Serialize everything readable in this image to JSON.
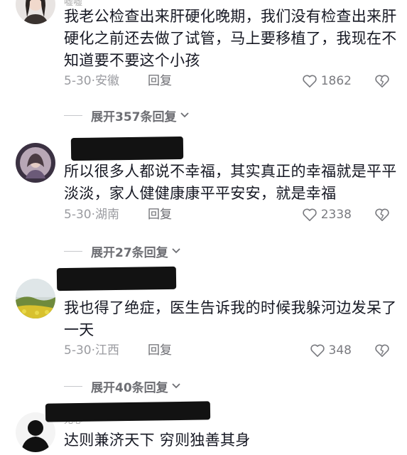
{
  "comments": [
    {
      "name_partial": "嘘嘘",
      "text": "我老公检查出来肝硬化晚期，我们没有检查出来肝硬化之前还去做了试管，马上要移植了，我现在不知道要不要这个小孩",
      "date": "5-30",
      "location": "安徽",
      "reply": "回复",
      "likes": "1862",
      "expand": "展开357条回复"
    },
    {
      "text": "所以很多人都说不幸福，其实真正的幸福就是平平淡淡，家人健健康康平平安安，就是幸福",
      "date": "5-30",
      "location": "湖南",
      "reply": "回复",
      "likes": "2338",
      "expand": "展开27条回复"
    },
    {
      "text": "我也得了绝症，医生告诉我的时候我躲河边发呆了一天",
      "date": "5-30",
      "location": "江西",
      "reply": "回复",
      "likes": "348",
      "expand": "展开40条回复"
    },
    {
      "name_partial": "无心",
      "text": "达则兼济天下 穷则独善其身"
    }
  ],
  "colors": {
    "text": "#161823",
    "meta": "#9a9ba0",
    "redaction": "#121212"
  },
  "icons": [
    "heart-outline-icon",
    "broken-heart-icon",
    "chevron-down-icon"
  ]
}
